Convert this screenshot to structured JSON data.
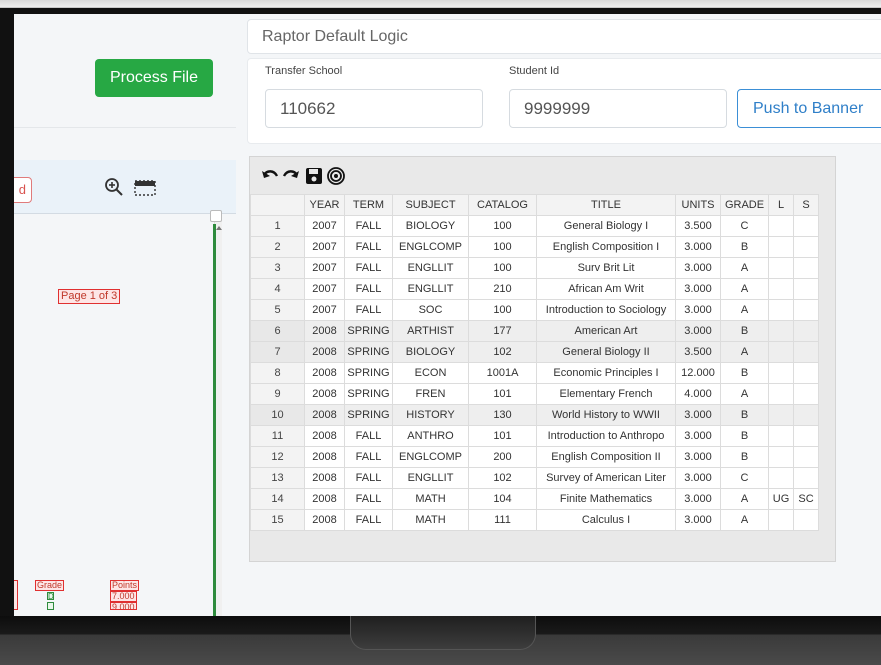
{
  "left_panel": {
    "process_button": "Process File",
    "partial_button": "d",
    "pdf": {
      "page_label": "Page 1 of 3",
      "grade_header": "Grade",
      "grade_value": "D",
      "points_header": "Points",
      "points_value_1": "7.000",
      "points_value_2": "9.000"
    }
  },
  "logic_title": "Raptor Default Logic",
  "form": {
    "transfer_school_label": "Transfer School",
    "transfer_school_value": "110662",
    "student_id_label": "Student Id",
    "student_id_value": "9999999",
    "push_button": "Push to Banner"
  },
  "toolbar_icons": [
    "undo-icon",
    "redo-icon",
    "save-icon",
    "spiral-icon"
  ],
  "table": {
    "headers": [
      "",
      "YEAR",
      "TERM",
      "SUBJECT",
      "CATALOG",
      "TITLE",
      "UNITS",
      "GRADE",
      "L",
      "S"
    ],
    "rows": [
      [
        "1",
        "2007",
        "FALL",
        "BIOLOGY",
        "100",
        "General Biology I",
        "3.500",
        "C",
        "",
        ""
      ],
      [
        "2",
        "2007",
        "FALL",
        "ENGLCOMP",
        "100",
        "English Composition I",
        "3.000",
        "B",
        "",
        ""
      ],
      [
        "3",
        "2007",
        "FALL",
        "ENGLLIT",
        "100",
        "Surv Brit Lit",
        "3.000",
        "A",
        "",
        ""
      ],
      [
        "4",
        "2007",
        "FALL",
        "ENGLLIT",
        "210",
        "African Am Writ",
        "3.000",
        "A",
        "",
        ""
      ],
      [
        "5",
        "2007",
        "FALL",
        "SOC",
        "100",
        "Introduction to Sociology",
        "3.000",
        "A",
        "",
        ""
      ],
      [
        "6",
        "2008",
        "SPRING",
        "ARTHIST",
        "177",
        "American Art",
        "3.000",
        "B",
        "",
        ""
      ],
      [
        "7",
        "2008",
        "SPRING",
        "BIOLOGY",
        "102",
        "General Biology II",
        "3.500",
        "A",
        "",
        ""
      ],
      [
        "8",
        "2008",
        "SPRING",
        "ECON",
        "1001A",
        "Economic Principles I",
        "12.000",
        "B",
        "",
        ""
      ],
      [
        "9",
        "2008",
        "SPRING",
        "FREN",
        "101",
        "Elementary French",
        "4.000",
        "A",
        "",
        ""
      ],
      [
        "10",
        "2008",
        "SPRING",
        "HISTORY",
        "130",
        "World History to WWII",
        "3.000",
        "B",
        "",
        ""
      ],
      [
        "11",
        "2008",
        "FALL",
        "ANTHRO",
        "101",
        "Introduction to Anthropo",
        "3.000",
        "B",
        "",
        ""
      ],
      [
        "12",
        "2008",
        "FALL",
        "ENGLCOMP",
        "200",
        "English Composition II",
        "3.000",
        "B",
        "",
        ""
      ],
      [
        "13",
        "2008",
        "FALL",
        "ENGLLIT",
        "102",
        "Survey of American Liter",
        "3.000",
        "C",
        "",
        ""
      ],
      [
        "14",
        "2008",
        "FALL",
        "MATH",
        "104",
        "Finite Mathematics",
        "3.000",
        "A",
        "UG",
        "SC"
      ],
      [
        "15",
        "2008",
        "FALL",
        "MATH",
        "111",
        "Calculus I",
        "3.000",
        "A",
        "",
        ""
      ]
    ]
  }
}
